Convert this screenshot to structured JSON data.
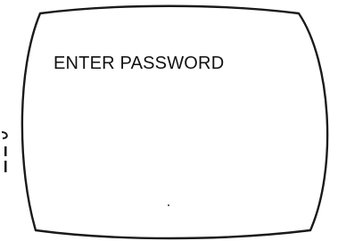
{
  "screen": {
    "prompt": "ENTER PASSWORD"
  },
  "colors": {
    "background": "#ffffff",
    "ink": "#111111"
  }
}
